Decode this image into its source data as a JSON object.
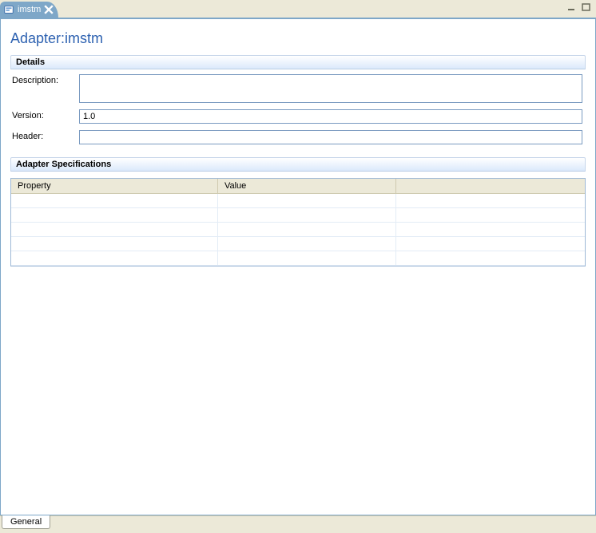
{
  "tab": {
    "title": "imstm"
  },
  "page": {
    "title": "Adapter:imstm"
  },
  "sections": {
    "details": {
      "title": "Details",
      "fields": {
        "description": {
          "label": "Description:",
          "value": ""
        },
        "version": {
          "label": "Version:",
          "value": "1.0"
        },
        "header": {
          "label": "Header:",
          "value": ""
        }
      }
    },
    "specs": {
      "title": "Adapter Specifications",
      "columns": {
        "property": "Property",
        "value": "Value",
        "blank": ""
      },
      "rows": [
        {
          "property": "",
          "value": "",
          "c3": ""
        },
        {
          "property": "",
          "value": "",
          "c3": ""
        },
        {
          "property": "",
          "value": "",
          "c3": ""
        },
        {
          "property": "",
          "value": "",
          "c3": ""
        },
        {
          "property": "",
          "value": "",
          "c3": ""
        }
      ]
    }
  },
  "bottomTabs": {
    "general": "General"
  }
}
